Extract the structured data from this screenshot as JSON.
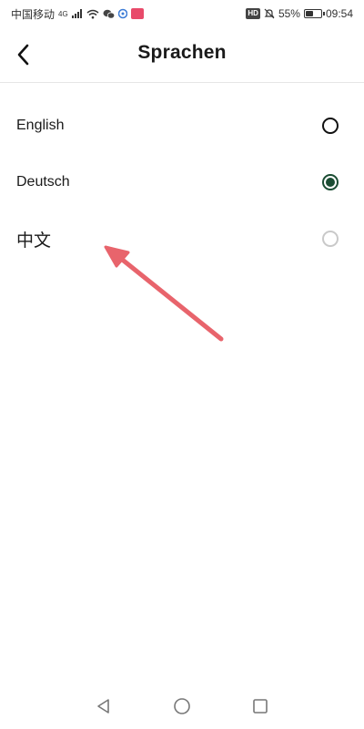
{
  "status_bar": {
    "carrier": "中国移动",
    "network": "4G",
    "battery": "55%",
    "battery_level": 0.55,
    "time": "09:54",
    "hd_label": "HD"
  },
  "header": {
    "title": "Sprachen",
    "back_icon": "chevron-left-icon"
  },
  "languages": [
    {
      "label": "English",
      "state": "unselected"
    },
    {
      "label": "Deutsch",
      "state": "selected"
    },
    {
      "label": "中文",
      "state": "disabled"
    }
  ],
  "colors": {
    "selected_radio": "#1b4d33",
    "annotation_arrow": "#e8646c"
  },
  "nav_bar": {
    "back_icon": "triangle-back-icon",
    "home_icon": "circle-home-icon",
    "recents_icon": "square-recents-icon"
  }
}
